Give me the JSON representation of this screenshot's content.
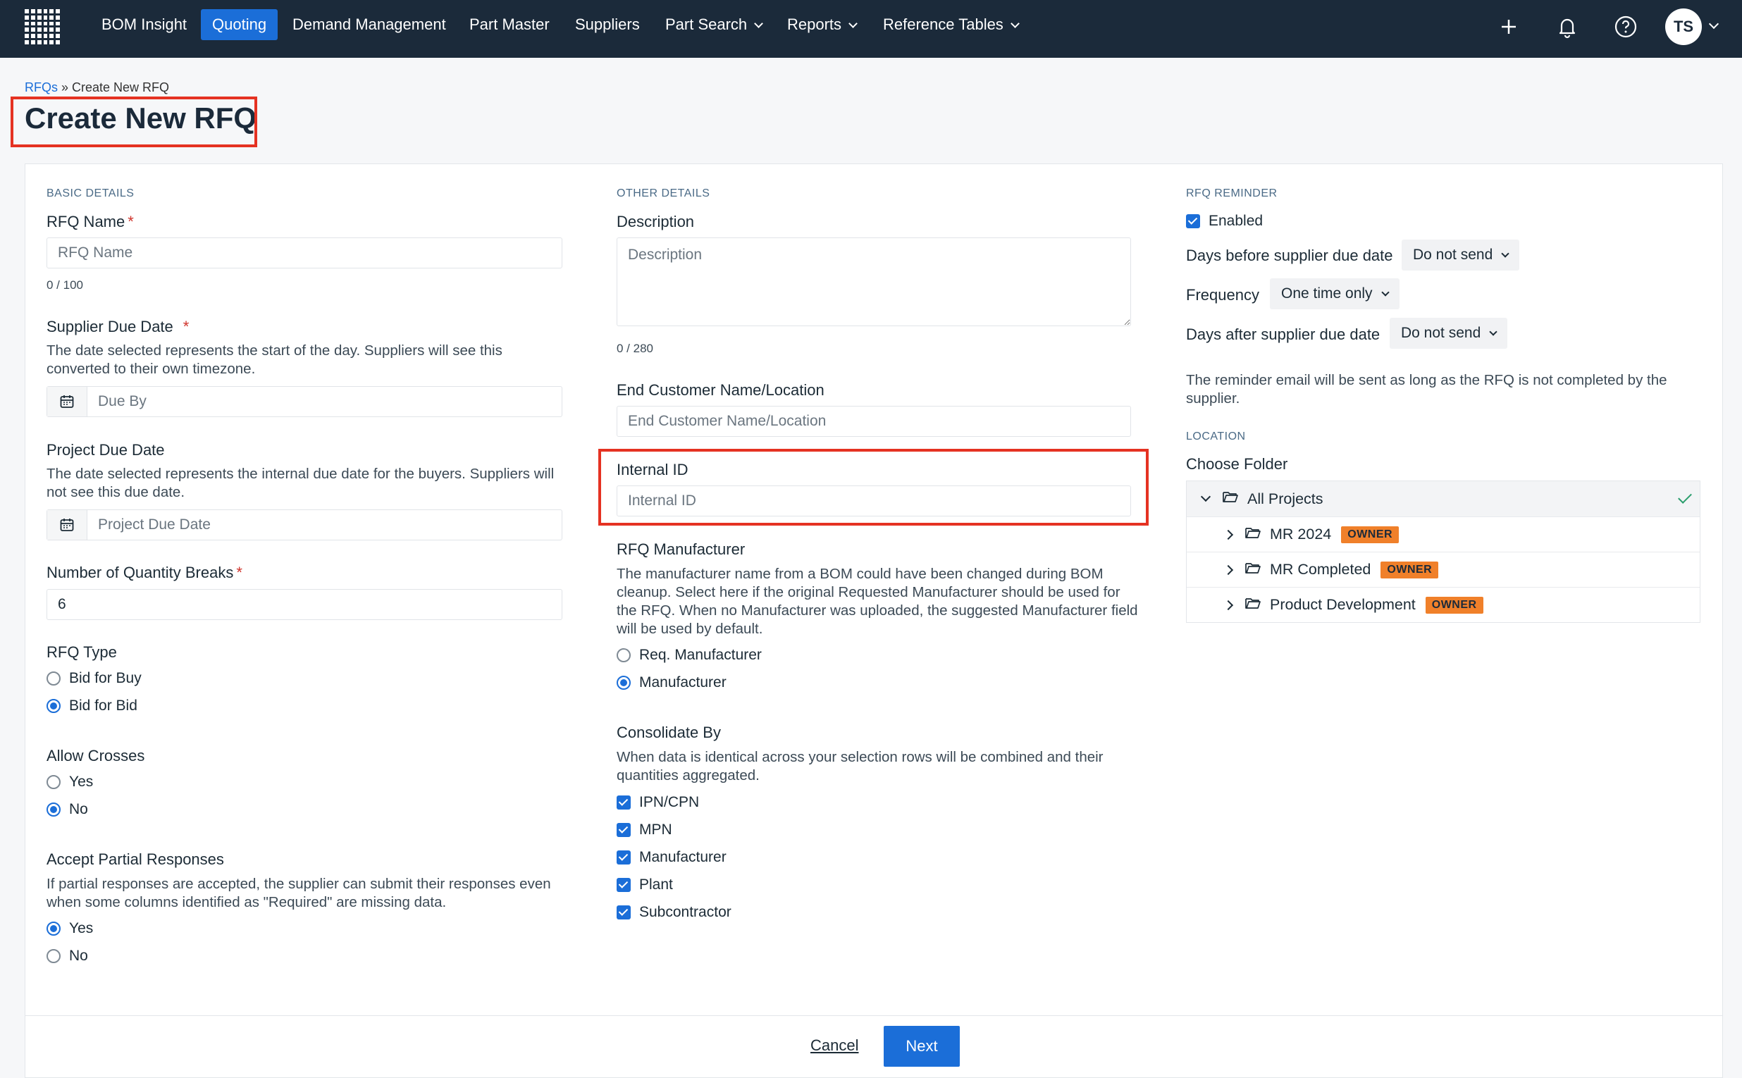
{
  "colors": {
    "nav_bg": "#1b2a3a",
    "accent": "#1b6ed8",
    "highlight": "#e53222",
    "owner_badge": "#f0802a",
    "success": "#2a9d6c"
  },
  "nav": {
    "items": [
      {
        "label": "BOM Insight",
        "active": false,
        "dropdown": false
      },
      {
        "label": "Quoting",
        "active": true,
        "dropdown": false
      },
      {
        "label": "Demand Management",
        "active": false,
        "dropdown": false
      },
      {
        "label": "Part Master",
        "active": false,
        "dropdown": false
      },
      {
        "label": "Suppliers",
        "active": false,
        "dropdown": false
      },
      {
        "label": "Part Search",
        "active": false,
        "dropdown": true
      },
      {
        "label": "Reports",
        "active": false,
        "dropdown": true
      },
      {
        "label": "Reference Tables",
        "active": false,
        "dropdown": true
      }
    ],
    "icons": [
      "plus-icon",
      "bell-icon",
      "help-icon"
    ],
    "avatar_initials": "TS"
  },
  "breadcrumb": {
    "root": "RFQs",
    "separator": " » ",
    "current": "Create New RFQ"
  },
  "page_title": "Create New RFQ",
  "basic": {
    "section": "BASIC DETAILS",
    "rfq_name": {
      "label": "RFQ Name",
      "required": "*",
      "placeholder": "RFQ Name",
      "counter": "0 / 100"
    },
    "supplier_due": {
      "label": "Supplier Due Date",
      "required": "*",
      "help": "The date selected represents the start of the day. Suppliers will see this converted to their own timezone.",
      "placeholder": "Due By"
    },
    "project_due": {
      "label": "Project Due Date",
      "help": "The date selected represents the internal due date for the buyers. Suppliers will not see this due date.",
      "placeholder": "Project Due Date"
    },
    "qty_breaks": {
      "label": "Number of Quantity Breaks",
      "required": "*",
      "value": "6"
    },
    "rfq_type": {
      "label": "RFQ Type",
      "options": [
        "Bid for Buy",
        "Bid for Bid"
      ],
      "selected": "Bid for Bid"
    },
    "allow_crosses": {
      "label": "Allow Crosses",
      "options": [
        "Yes",
        "No"
      ],
      "selected": "No"
    },
    "partial": {
      "label": "Accept Partial Responses",
      "help": "If partial responses are accepted, the supplier can submit their responses even when some columns identified as \"Required\" are missing data.",
      "options": [
        "Yes",
        "No"
      ],
      "selected": "Yes"
    }
  },
  "other": {
    "section": "OTHER DETAILS",
    "description": {
      "label": "Description",
      "placeholder": "Description",
      "counter": "0 / 280"
    },
    "end_customer": {
      "label": "End Customer Name/Location",
      "placeholder": "End Customer Name/Location"
    },
    "internal_id": {
      "label": "Internal ID",
      "placeholder": "Internal ID"
    },
    "manufacturer": {
      "label": "RFQ Manufacturer",
      "help": "The manufacturer name from a BOM could have been changed during BOM cleanup. Select here if the original Requested Manufacturer should be used for the RFQ. When no Manufacturer was uploaded, the suggested Manufacturer field will be used by default.",
      "options": [
        "Req. Manufacturer",
        "Manufacturer"
      ],
      "selected": "Manufacturer"
    },
    "consolidate": {
      "label": "Consolidate By",
      "help": "When data is identical across your selection rows will be combined and their quantities aggregated.",
      "options": [
        "IPN/CPN",
        "MPN",
        "Manufacturer",
        "Plant",
        "Subcontractor"
      ],
      "checked": [
        true,
        true,
        true,
        true,
        true
      ]
    }
  },
  "reminder": {
    "section": "RFQ REMINDER",
    "enabled_label": "Enabled",
    "enabled": true,
    "days_before": {
      "label": "Days before supplier due date",
      "value": "Do not send"
    },
    "frequency": {
      "label": "Frequency",
      "value": "One time only"
    },
    "days_after": {
      "label": "Days after supplier due date",
      "value": "Do not send"
    },
    "note": "The reminder email will be sent as long as the RFQ is not completed by the supplier."
  },
  "location": {
    "section": "LOCATION",
    "label": "Choose Folder",
    "root": "All Projects",
    "folders": [
      {
        "name": "MR 2024",
        "badge": "OWNER"
      },
      {
        "name": "MR Completed",
        "badge": "OWNER"
      },
      {
        "name": "Product Development",
        "badge": "OWNER"
      }
    ]
  },
  "footer": {
    "cancel": "Cancel",
    "next": "Next"
  }
}
